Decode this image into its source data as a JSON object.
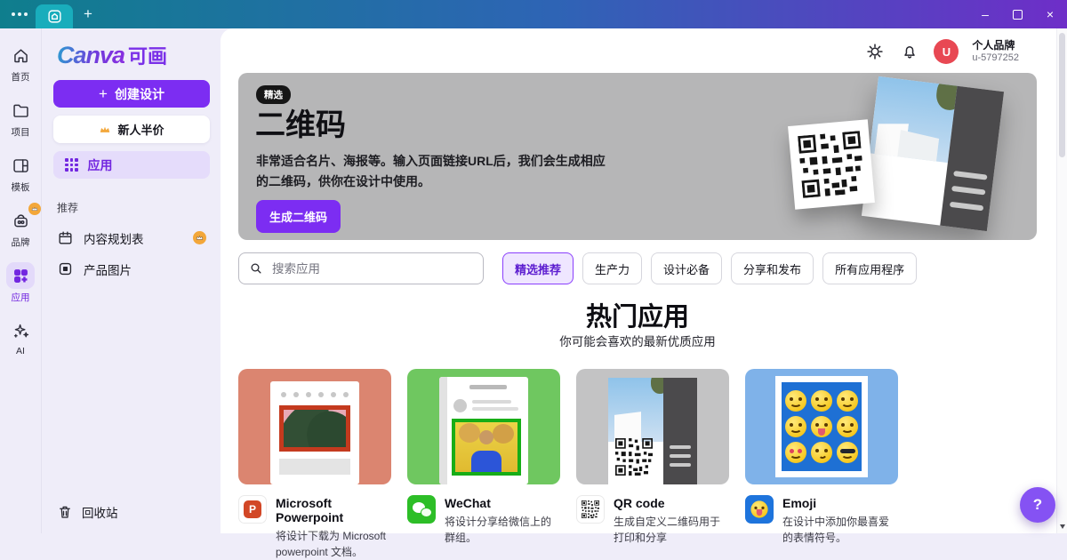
{
  "window": {
    "new_tab_label": "+",
    "controls": {
      "minimize": "–",
      "close": "×"
    }
  },
  "sidebar_rail": {
    "items": [
      {
        "label": "首页",
        "icon": "home-icon",
        "active": false
      },
      {
        "label": "项目",
        "icon": "folder-icon",
        "active": false
      },
      {
        "label": "模板",
        "icon": "template-icon",
        "active": false
      },
      {
        "label": "品牌",
        "icon": "brand-icon",
        "active": false,
        "badge": "crown"
      },
      {
        "label": "应用",
        "icon": "apps-icon",
        "active": true
      },
      {
        "label": "AI",
        "icon": "ai-sparkle-icon",
        "active": false
      }
    ]
  },
  "sidebar_panel": {
    "logo": {
      "brand": "Canva",
      "suffix": "可画"
    },
    "create_button": "创建设计",
    "create_plus": "+",
    "promo_button": "新人半价",
    "apps_item": "应用",
    "recommend_label": "推荐",
    "recommend_items": [
      {
        "label": "内容规划表",
        "icon": "calendar-icon",
        "badge": "crown"
      },
      {
        "label": "产品图片",
        "icon": "product-image-icon"
      }
    ],
    "trash_label": "回收站"
  },
  "header": {
    "profile_name": "个人品牌",
    "profile_id": "u-5797252",
    "avatar_letter": "U"
  },
  "hero": {
    "badge": "精选",
    "title": "二维码",
    "description": "非常适合名片、海报等。输入页面链接URL后，我们会生成相应的二维码，供你在设计中使用。",
    "cta": "生成二维码"
  },
  "search": {
    "placeholder": "搜索应用"
  },
  "filter_tabs": [
    {
      "label": "精选推荐",
      "active": true
    },
    {
      "label": "生产力",
      "active": false
    },
    {
      "label": "设计必备",
      "active": false
    },
    {
      "label": "分享和发布",
      "active": false
    },
    {
      "label": "所有应用程序",
      "active": false
    }
  ],
  "section": {
    "title": "热门应用",
    "subtitle": "你可能会喜欢的最新优质应用"
  },
  "apps": [
    {
      "name": "Microsoft Powerpoint",
      "description": "将设计下载为 Microsoft powerpoint 文档。",
      "icon": "powerpoint-icon",
      "icon_letter": "P",
      "tile_color": "#DB8570"
    },
    {
      "name": "WeChat",
      "description": "将设计分享给微信上的群组。",
      "icon": "wechat-icon",
      "tile_color": "#6FC760"
    },
    {
      "name": "QR code",
      "description": "生成自定义二维码用于打印和分享",
      "icon": "qr-code-icon",
      "tile_color": "#C3C3C4"
    },
    {
      "name": "Emoji",
      "description": "在设计中添加你最喜爱的表情符号。",
      "icon": "emoji-icon",
      "tile_color": "#7FB2E9",
      "faces": [
        "laugh-sweat",
        "joy",
        "halo",
        "blush",
        "tongue-out",
        "relieved",
        "heart-eyes",
        "smirk",
        "sunglasses"
      ]
    }
  ],
  "help_button": "?",
  "colors": {
    "titlebar_teal": "#0F7E8D",
    "titlebar_purple": "#6E2EC8",
    "tab_teal": "#19ADBC",
    "accent_purple": "#7C2DF2",
    "active_chip_purple": "#8A3FFC",
    "sidebar_bg": "#EFEDF9",
    "hero_gray": "#B6B6B7",
    "avatar_red": "#E84853",
    "crown_orange": "#F3A73A",
    "wechat_green": "#2DBE27",
    "powerpoint_red": "#D24726",
    "emoji_blue": "#1E74DC",
    "help_purple": "#8552F3"
  }
}
